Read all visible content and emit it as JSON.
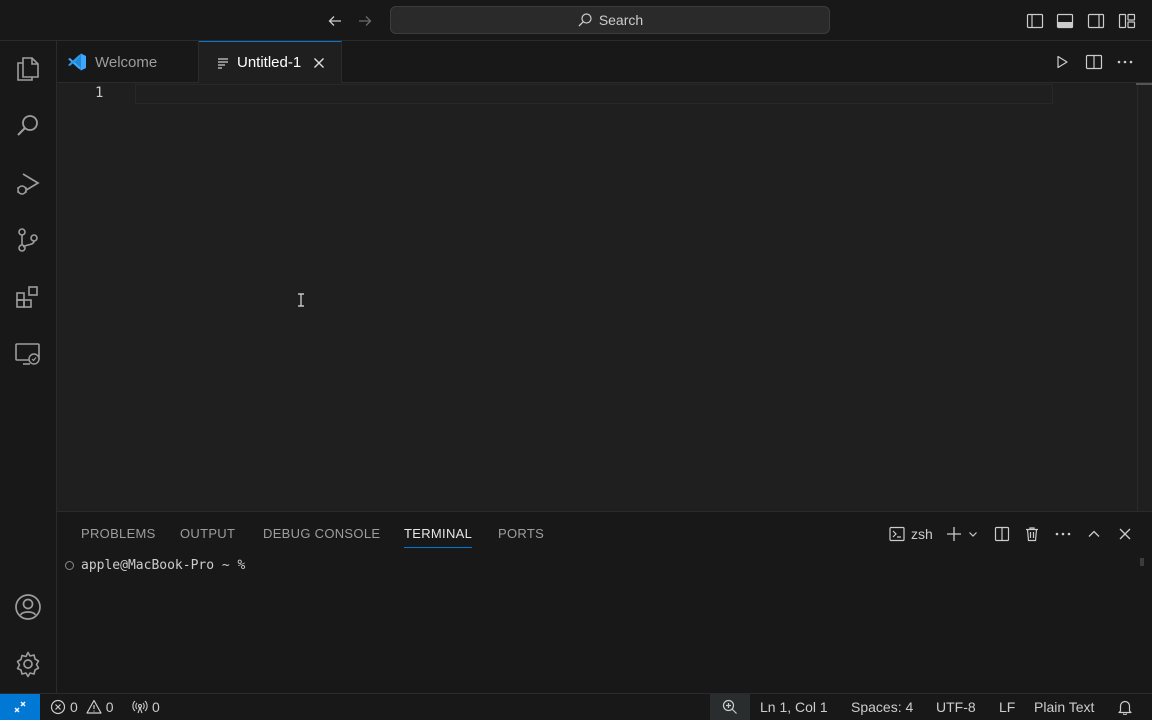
{
  "titlebar": {
    "search_label": "Search"
  },
  "tabs": [
    {
      "label": "Welcome",
      "active": false
    },
    {
      "label": "Untitled-1",
      "active": true
    }
  ],
  "editor": {
    "line_number": "1"
  },
  "panel": {
    "tabs": [
      "PROBLEMS",
      "OUTPUT",
      "DEBUG CONSOLE",
      "TERMINAL",
      "PORTS"
    ],
    "active_tab": "TERMINAL",
    "terminal_shell": "zsh",
    "prompt": "apple@MacBook-Pro ~ %"
  },
  "statusbar": {
    "errors": "0",
    "warnings": "0",
    "ports": "0",
    "position": "Ln 1, Col 1",
    "spaces": "Spaces: 4",
    "encoding": "UTF-8",
    "eol": "LF",
    "language": "Plain Text"
  },
  "colors": {
    "accent": "#0078d4",
    "background": "#1f1f1f",
    "chrome": "#181818",
    "vscode_logo": "#3ea6ff"
  }
}
